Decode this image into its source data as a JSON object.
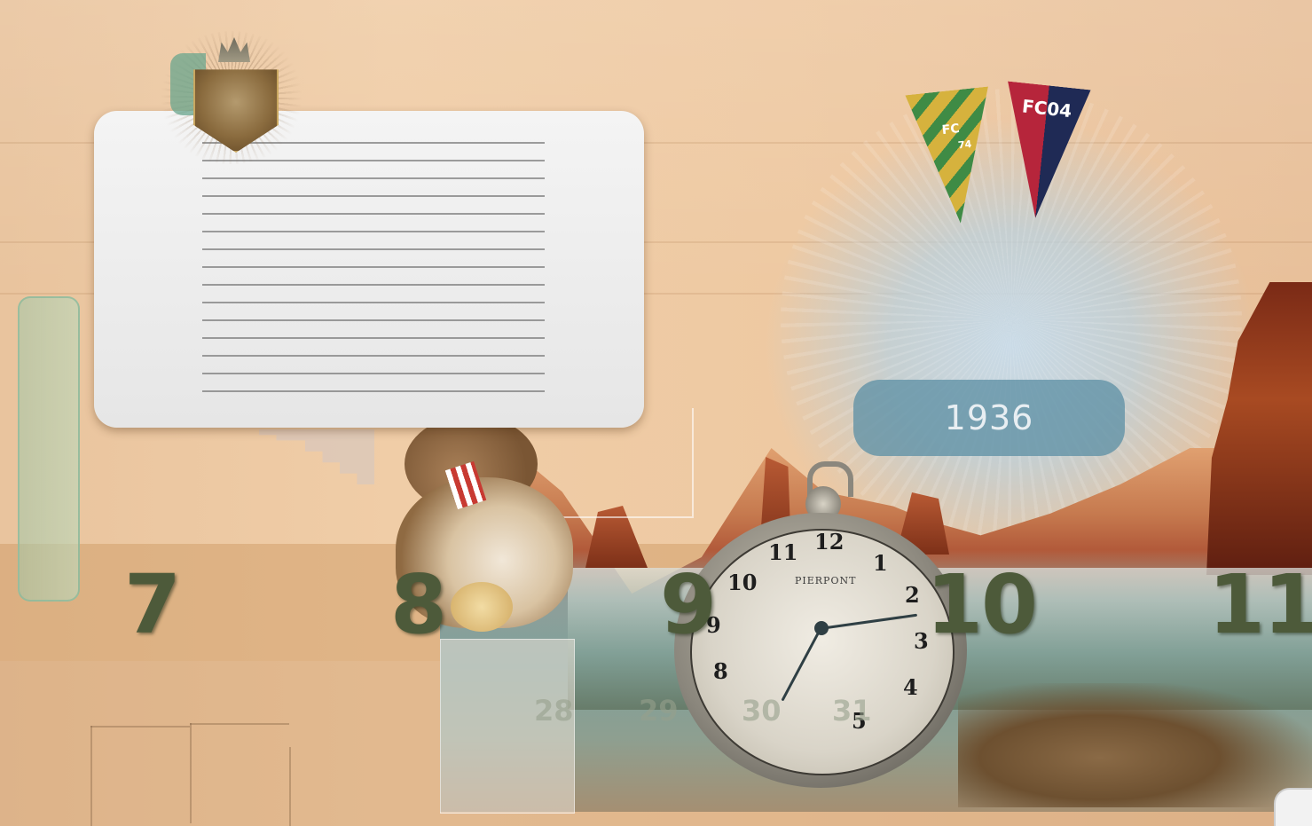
{
  "timeline": {
    "year": "1936",
    "months": [
      "7",
      "8",
      "9",
      "10",
      "11"
    ],
    "days": [
      "28",
      "29",
      "30",
      "31"
    ]
  },
  "note_card": {
    "lines": 15
  },
  "pennants": [
    {
      "text_top": "FC",
      "text_bottom": "74",
      "colors": [
        "#d9b23c",
        "#3e8a43"
      ]
    },
    {
      "text_top": "FC04",
      "text_bottom": "",
      "colors": [
        "#b5243a",
        "#1f2a55"
      ]
    }
  ],
  "pocket_watch": {
    "brand": "PIERPONT",
    "numerals": [
      "12",
      "1",
      "2",
      "3",
      "4",
      "5",
      "8",
      "9",
      "10",
      "11"
    ]
  },
  "colors": {
    "paper": "#eec9a2",
    "pill": "#5f91a5",
    "digits": "#4d5a3a"
  },
  "icons": [
    "crest-icon",
    "pennant-icon",
    "pocket-watch-icon",
    "teddy-bear-icon"
  ]
}
